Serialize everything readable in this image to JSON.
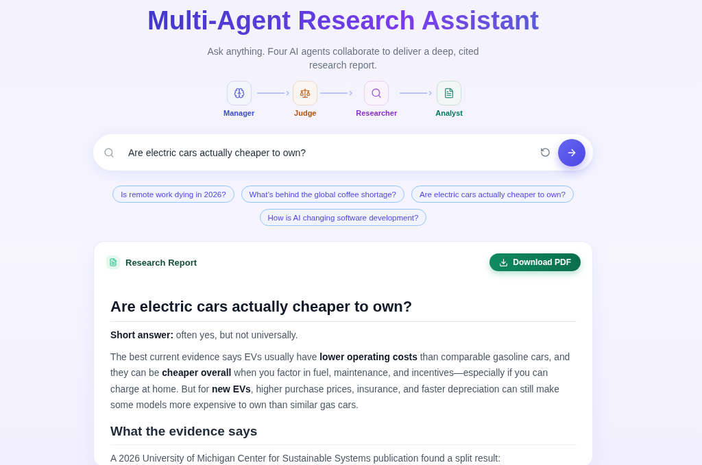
{
  "header": {
    "title": "Multi-Agent Research Assistant",
    "subtitle": "Ask anything. Four AI agents collaborate to deliver a deep, cited research report."
  },
  "pipeline": [
    {
      "label": "Manager",
      "color": "#3b4cca"
    },
    {
      "label": "Judge",
      "color": "#b45309"
    },
    {
      "label": "Researcher",
      "color": "#8b2fc9"
    },
    {
      "label": "Analyst",
      "color": "#047857"
    }
  ],
  "search": {
    "value": "Are electric cars actually cheaper to own?"
  },
  "suggestions": [
    "Is remote work dying in 2026?",
    "What’s behind the global coffee shortage?",
    "Are electric cars actually cheaper to own?",
    "How is AI changing software development?"
  ],
  "report": {
    "title": "Research Report",
    "download_button": "Download PDF",
    "content": [
      {
        "kind": "h1",
        "text": "Are electric cars actually cheaper to own?"
      },
      {
        "kind": "p",
        "text": "**Short answer:** often yes, but not universally."
      },
      {
        "kind": "p",
        "text": "The best current evidence says EVs usually have **lower operating costs** than comparable gasoline cars, and they can be **cheaper overall** when you factor in fuel, maintenance, and incentives—especially if you can charge at home. But for **new EVs**, higher purchase prices, insurance, and faster depreciation can still make some models more expensive to own than similar gas cars."
      },
      {
        "kind": "h2",
        "text": "What the evidence says"
      },
      {
        "kind": "p",
        "text": "A 2026 University of Michigan Center for Sustainable Systems publication found a split result:"
      }
    ]
  }
}
